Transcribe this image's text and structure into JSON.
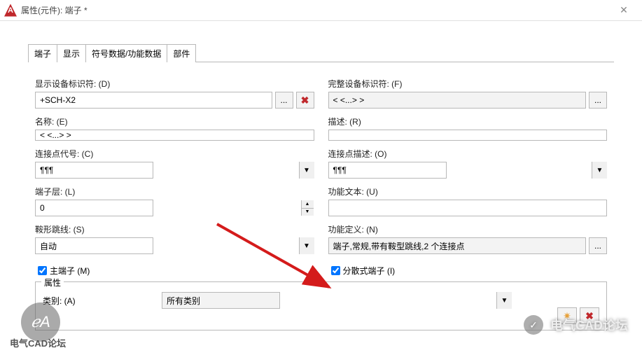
{
  "window": {
    "title": "属性(元件): 端子 *",
    "close": "✕"
  },
  "tabs": {
    "t1": "端子",
    "t2": "显示",
    "t3": "符号数据/功能数据",
    "t4": "部件"
  },
  "left": {
    "disp_id_label": "显示设备标识符: (D)",
    "disp_id_value": "+SCH-X2",
    "name_label": "名称: (E)",
    "name_value": "< <...> >",
    "conn_code_label": "连接点代号: (C)",
    "conn_code_value": "¶¶¶",
    "layer_label": "端子层: (L)",
    "layer_value": "0",
    "jumper_label": "鞍形跳线: (S)",
    "jumper_value": "自动",
    "main_term": "主端子 (M)"
  },
  "right": {
    "full_id_label": "完整设备标识符: (F)",
    "full_id_value": "< <...> >",
    "desc_label": "描述: (R)",
    "desc_value": "",
    "conn_desc_label": "连接点描述: (O)",
    "conn_desc_value": "¶¶¶",
    "func_text_label": "功能文本: (U)",
    "func_text_value": "",
    "func_def_label": "功能定义: (N)",
    "func_def_value": "端子,常规,带有鞍型跳线,2 个连接点",
    "dist_term": "分散式端子 (I)"
  },
  "group": {
    "title": "属性",
    "cat_label": "类别: (A)",
    "cat_value": "所有类别"
  },
  "icons": {
    "dots": "...",
    "x": "✖",
    "up": "▲",
    "dn": "▼",
    "drop": "▼",
    "star": "✷"
  },
  "watermark": {
    "circle": "ℯA",
    "left": "电气CAD论坛",
    "right": "电气CAD论坛",
    "wechat": "✓"
  }
}
